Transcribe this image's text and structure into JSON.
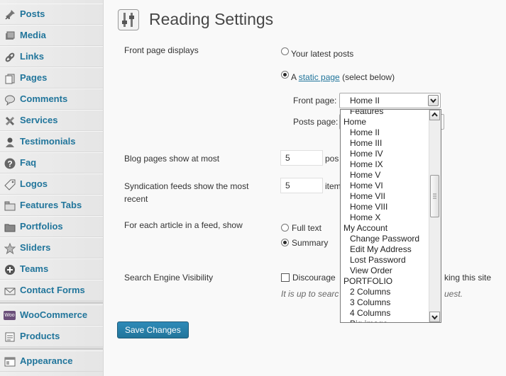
{
  "sidebar": {
    "items": [
      {
        "label": "Posts",
        "icon": "pin-icon"
      },
      {
        "label": "Media",
        "icon": "media-icon"
      },
      {
        "label": "Links",
        "icon": "link-icon"
      },
      {
        "label": "Pages",
        "icon": "pages-icon"
      },
      {
        "label": "Comments",
        "icon": "comment-icon"
      },
      {
        "label": "Services",
        "icon": "tools-icon"
      },
      {
        "label": "Testimonials",
        "icon": "person-icon"
      },
      {
        "label": "Faq",
        "icon": "question-icon"
      },
      {
        "label": "Logos",
        "icon": "tag-icon"
      },
      {
        "label": "Features Tabs",
        "icon": "tabs-icon"
      },
      {
        "label": "Portfolios",
        "icon": "folder-icon"
      },
      {
        "label": "Sliders",
        "icon": "star-icon"
      },
      {
        "label": "Teams",
        "icon": "plus-circle-icon"
      },
      {
        "label": "Contact Forms",
        "icon": "mail-icon"
      },
      {
        "label": "WooCommerce",
        "icon": "woo-icon",
        "badge": "Woo"
      },
      {
        "label": "Products",
        "icon": "products-icon"
      },
      {
        "label": "Appearance",
        "icon": "appearance-icon"
      }
    ]
  },
  "page": {
    "title": "Reading Settings"
  },
  "settings": {
    "front_page_displays": {
      "label": "Front page displays",
      "opt_latest": "Your latest posts",
      "opt_static_prefix": "A ",
      "opt_static_link": "static page",
      "opt_static_suffix": " (select below)",
      "front_page_label": "Front page:",
      "front_page_value": "Home II",
      "posts_page_label": "Posts page:"
    },
    "blog_pages": {
      "label": "Blog pages show at most",
      "value": "5",
      "unit_partial": "pos"
    },
    "syndication": {
      "label_line1": "Syndication feeds show the most",
      "label_line2": "recent",
      "value": "5",
      "unit_partial": "item"
    },
    "feed_article": {
      "label": "For each article in a feed, show",
      "opt_full": "Full text",
      "opt_summary": "Summary"
    },
    "search_engine": {
      "label": "Search Engine Visibility",
      "check_label_partial": "Discourage",
      "check_label_tail": "king this site",
      "note_partial": "It is up to searc",
      "note_tail": "uest."
    },
    "save_button": "Save Changes"
  },
  "dropdown": {
    "items": [
      {
        "text": "Features",
        "level": 1
      },
      {
        "text": "Home",
        "level": 0
      },
      {
        "text": "Home II",
        "level": 1
      },
      {
        "text": "Home III",
        "level": 1
      },
      {
        "text": "Home IV",
        "level": 1
      },
      {
        "text": "Home IX",
        "level": 1
      },
      {
        "text": "Home V",
        "level": 1
      },
      {
        "text": "Home VI",
        "level": 1
      },
      {
        "text": "Home VII",
        "level": 1
      },
      {
        "text": "Home VIII",
        "level": 1
      },
      {
        "text": "Home X",
        "level": 1
      },
      {
        "text": "My Account",
        "level": 0
      },
      {
        "text": "Change Password",
        "level": 1
      },
      {
        "text": "Edit My Address",
        "level": 1
      },
      {
        "text": "Lost Password",
        "level": 1
      },
      {
        "text": "View Order",
        "level": 1
      },
      {
        "text": "PORTFOLIO",
        "level": 0
      },
      {
        "text": "2 Columns",
        "level": 1
      },
      {
        "text": "3 Columns",
        "level": 1
      },
      {
        "text": "4 Columns",
        "level": 1
      },
      {
        "text": "Big image",
        "level": 1
      }
    ]
  },
  "colors": {
    "link": "#21759b",
    "button": "#21759b",
    "sidebar_bg": "#ececec"
  }
}
